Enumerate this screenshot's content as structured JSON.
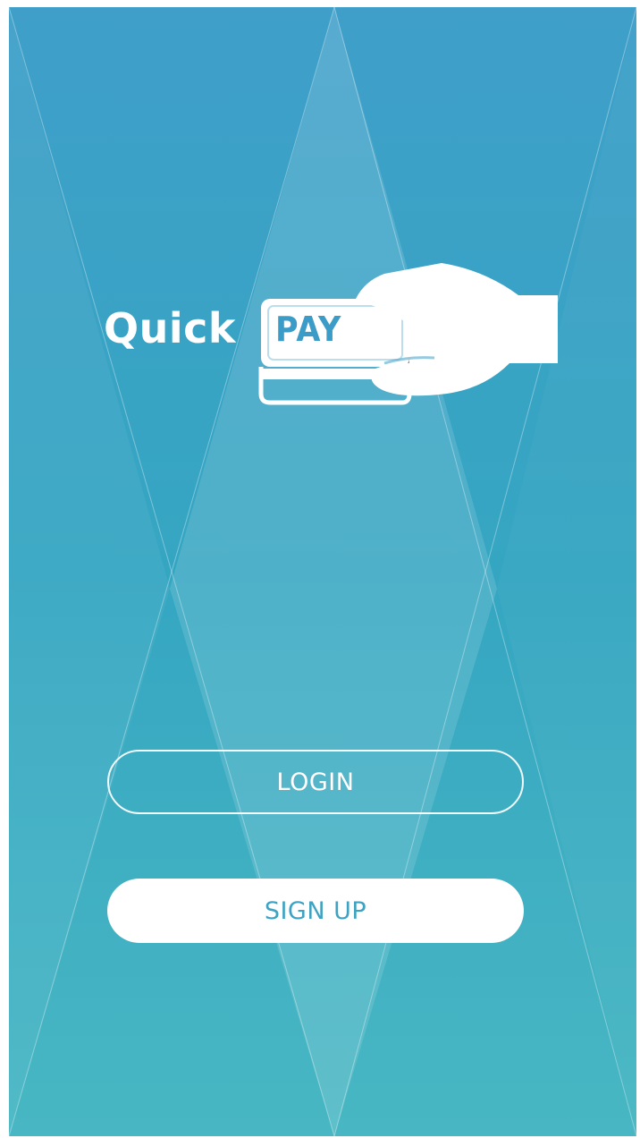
{
  "logo": {
    "quick_text": "Quick",
    "pay_text": "PAY"
  },
  "buttons": {
    "login_label": "LOGIN",
    "signup_label": "SIGN UP"
  },
  "colors": {
    "background_top": "#3f9fc9",
    "background_bottom": "#48b7c3",
    "button_text_accent": "#3ea3c2",
    "white": "#ffffff"
  }
}
